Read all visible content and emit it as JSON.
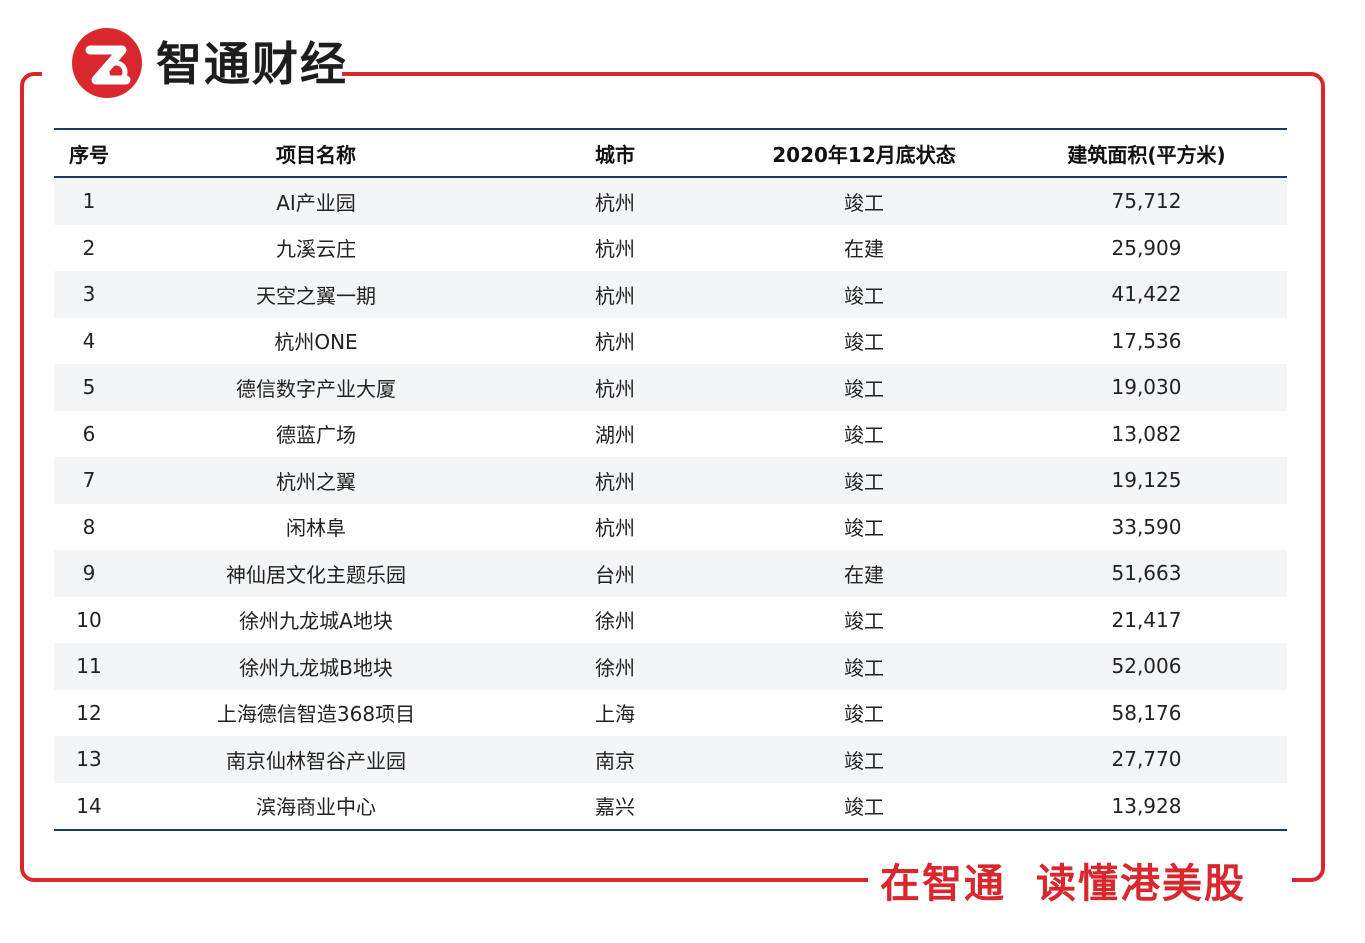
{
  "brand": {
    "name": "智通财经",
    "logo_letter": "Z",
    "slogan_part1": "在智通",
    "slogan_part2": "读懂港美股",
    "accent_color": "#d9272e",
    "table_rule_color": "#1f3864"
  },
  "table": {
    "headers": [
      "序号",
      "项目名称",
      "城市",
      "2020年12月底状态",
      "建筑面积(平方米)"
    ],
    "rows": [
      [
        "1",
        "AI产业园",
        "杭州",
        "竣工",
        "75,712"
      ],
      [
        "2",
        "九溪云庄",
        "杭州",
        "在建",
        "25,909"
      ],
      [
        "3",
        "天空之翼一期",
        "杭州",
        "竣工",
        "41,422"
      ],
      [
        "4",
        "杭州ONE",
        "杭州",
        "竣工",
        "17,536"
      ],
      [
        "5",
        "德信数字产业大厦",
        "杭州",
        "竣工",
        "19,030"
      ],
      [
        "6",
        "德蓝广场",
        "湖州",
        "竣工",
        "13,082"
      ],
      [
        "7",
        "杭州之翼",
        "杭州",
        "竣工",
        "19,125"
      ],
      [
        "8",
        "闲林阜",
        "杭州",
        "竣工",
        "33,590"
      ],
      [
        "9",
        "神仙居文化主题乐园",
        "台州",
        "在建",
        "51,663"
      ],
      [
        "10",
        "徐州九龙城A地块",
        "徐州",
        "竣工",
        "21,417"
      ],
      [
        "11",
        "徐州九龙城B地块",
        "徐州",
        "竣工",
        "52,006"
      ],
      [
        "12",
        "上海德信智造368项目",
        "上海",
        "竣工",
        "58,176"
      ],
      [
        "13",
        "南京仙林智谷产业园",
        "南京",
        "竣工",
        "27,770"
      ],
      [
        "14",
        "滨海商业中心",
        "嘉兴",
        "竣工",
        "13,928"
      ]
    ]
  }
}
